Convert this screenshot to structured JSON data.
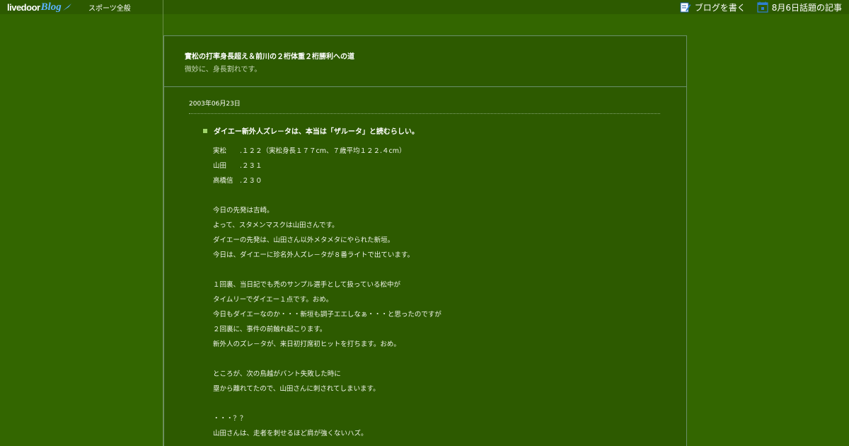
{
  "topbar": {
    "logo_livedoor": "livedoor",
    "logo_blog": "Blog",
    "category": "スポーツ全般",
    "write_blog": "ブログを書く",
    "trending": "8月6日話題の記事"
  },
  "header": {
    "title": "實松の打率身長超え＆前川の２桁体重２桁勝利への道",
    "description": "微妙に、身長割れです。"
  },
  "entry": {
    "date": "2003年06月23日",
    "title": "ダイエー新外人ズレ－タは、本当は「ザルータ」と読むらしい。",
    "lines": [
      "実松　　.１２２（実松身長１７７cm、７歳平均１２２.４cm）",
      "山田　　.２３１",
      "高橋信　.２３０",
      "",
      "今日の先発は吉崎。",
      "よって、スタメンマスクは山田さんです。",
      "ダイエーの先発は、山田さん以外メタメタにやられた新垣。",
      "今日は、ダイエーに珍名外人ズレ－タが８番ライトで出ています。",
      "",
      "１回裏、当日記でも禿のサンプル選手として扱っている松中が",
      "タイムリーでダイエー１点です。おめ。",
      "今日もダイエーなのか・・・新垣も調子エエしなぁ・・・と思ったのですが",
      "２回裏に、事件の前触れ起こります。",
      "新外人のズレ－タが、来日初打席初ヒットを打ちます。おめ。",
      "",
      "ところが、次の鳥越がバント失敗した時に",
      "塁から離れてたので、山田さんに刺されてしまいます。",
      "",
      "・・・？？",
      "山田さんは、走者を刺せるほど肩が強くないハズ。"
    ]
  },
  "colors": {
    "page_bg": "#336600",
    "panel_bg": "#2d5a00",
    "bullet": "#9fd46a"
  }
}
